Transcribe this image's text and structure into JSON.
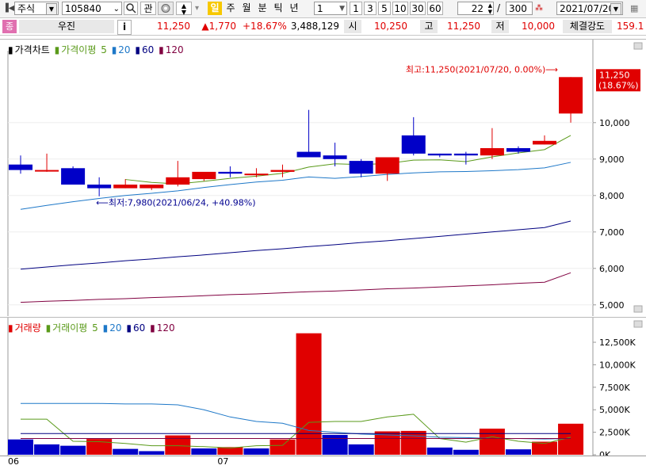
{
  "toolbar": {
    "market_type": "주식",
    "code": "105840",
    "search_icon_label": "search-icon",
    "watch_label": "관",
    "periods": [
      "일",
      "주",
      "월",
      "분",
      "틱",
      "년"
    ],
    "active_period": "일",
    "interval_value": "1",
    "intervals": [
      "1",
      "3",
      "5",
      "10",
      "30",
      "60"
    ],
    "count_value": "22",
    "slash": "/",
    "total_value": "300",
    "date_value": "2021/07/20"
  },
  "infobar": {
    "badge": "종",
    "name": "우진",
    "info_button": "i",
    "price": "11,250",
    "change": "▲1,770",
    "change_pct": "+18.67%",
    "volume": "3,488,129",
    "open_label": "시",
    "open_value": "10,250",
    "high_label": "고",
    "high_value": "11,250",
    "low_label": "저",
    "low_value": "10,000",
    "strength_label": "체결강도",
    "strength_value": "159.1"
  },
  "price_pane": {
    "legend_title": "가격차트",
    "legend_ma_label": "가격이평",
    "legend_periods": [
      "5",
      "20",
      "60",
      "120"
    ],
    "max_annotation": "최고:11,250(2021/07/20, 0.00%)⟶",
    "min_annotation": "⟵최저:7,980(2021/06/24, +40.98%)",
    "last_price_tag": "11,250",
    "last_pct_tag": "(18.67%)",
    "y_ticks": [
      "10,000",
      "9,000",
      "8,000",
      "7,000",
      "6,000",
      "5,000"
    ]
  },
  "volume_pane": {
    "legend_title": "거래량",
    "legend_ma_label": "거래이평",
    "legend_periods": [
      "5",
      "20",
      "60",
      "120"
    ],
    "y_ticks": [
      "12,500K",
      "10,000K",
      "7,500K",
      "5,000K",
      "2,500K",
      "0K"
    ]
  },
  "x_ticks": [
    "06",
    "07"
  ],
  "colors": {
    "up": "#e00000",
    "down": "#0000c8",
    "ma5": "#5a9a1a",
    "ma20": "#1e78c8",
    "ma60": "#000080",
    "ma120": "#800040"
  },
  "chart_data": [
    {
      "type": "candlestick",
      "title": "가격차트",
      "dates": [
        "2021/06/21",
        "2021/06/22",
        "2021/06/23",
        "2021/06/24",
        "2021/06/25",
        "2021/06/28",
        "2021/06/29",
        "2021/06/30",
        "2021/07/01",
        "2021/07/02",
        "2021/07/05",
        "2021/07/06",
        "2021/07/07",
        "2021/07/08",
        "2021/07/09",
        "2021/07/12",
        "2021/07/13",
        "2021/07/14",
        "2021/07/15",
        "2021/07/16",
        "2021/07/19",
        "2021/07/20"
      ],
      "open": [
        8850,
        8700,
        8750,
        8300,
        8200,
        8200,
        8300,
        8450,
        8650,
        8600,
        8650,
        9200,
        9100,
        8950,
        8600,
        9650,
        9150,
        9150,
        9100,
        9300,
        9400,
        10250
      ],
      "high": [
        9100,
        9150,
        8800,
        8500,
        8450,
        8300,
        8950,
        8600,
        8800,
        8750,
        8850,
        10350,
        9450,
        9000,
        9050,
        10150,
        9150,
        9200,
        9850,
        9350,
        9650,
        11250
      ],
      "low": [
        8600,
        8650,
        8300,
        7980,
        8200,
        8150,
        8250,
        8400,
        8500,
        8500,
        8500,
        9050,
        8800,
        8500,
        8400,
        9100,
        9050,
        8850,
        9000,
        9150,
        9400,
        10000
      ],
      "close": [
        8700,
        8700,
        8300,
        8200,
        8300,
        8300,
        8500,
        8650,
        8600,
        8600,
        8700,
        9050,
        9000,
        8600,
        9050,
        9150,
        9100,
        9100,
        9300,
        9200,
        9500,
        11250
      ],
      "ma_series": [
        {
          "name": "5",
          "values": [
            null,
            null,
            null,
            null,
            8440,
            8360,
            8320,
            8390,
            8470,
            8530,
            8610,
            8780,
            8870,
            8850,
            8880,
            8970,
            8980,
            8930,
            9060,
            9170,
            9260,
            9650
          ]
        },
        {
          "name": "20",
          "values": [
            7620,
            7730,
            7830,
            7920,
            8000,
            8060,
            8130,
            8220,
            8300,
            8370,
            8420,
            8510,
            8470,
            8520,
            8580,
            8620,
            8650,
            8660,
            8680,
            8710,
            8760,
            8910
          ]
        },
        {
          "name": "60",
          "values": [
            5980,
            6040,
            6100,
            6150,
            6210,
            6260,
            6320,
            6370,
            6430,
            6490,
            6540,
            6600,
            6650,
            6710,
            6760,
            6820,
            6880,
            6940,
            7000,
            7060,
            7120,
            7300
          ]
        },
        {
          "name": "120",
          "values": [
            5070,
            5100,
            5120,
            5150,
            5170,
            5200,
            5220,
            5250,
            5280,
            5300,
            5330,
            5360,
            5380,
            5410,
            5440,
            5460,
            5490,
            5520,
            5550,
            5590,
            5620,
            5880
          ]
        }
      ],
      "ylim": [
        4800,
        11800
      ]
    },
    {
      "type": "bar",
      "title": "거래량",
      "dates": [
        "2021/06/21",
        "2021/06/22",
        "2021/06/23",
        "2021/06/24",
        "2021/06/25",
        "2021/06/28",
        "2021/06/29",
        "2021/06/30",
        "2021/07/01",
        "2021/07/02",
        "2021/07/05",
        "2021/07/06",
        "2021/07/07",
        "2021/07/08",
        "2021/07/09",
        "2021/07/12",
        "2021/07/13",
        "2021/07/14",
        "2021/07/15",
        "2021/07/16",
        "2021/07/19",
        "2021/07/20"
      ],
      "values": [
        1700,
        1150,
        1000,
        1750,
        650,
        400,
        2150,
        700,
        850,
        700,
        1700,
        13500,
        2200,
        1150,
        2600,
        2650,
        800,
        550,
        2900,
        600,
        1450,
        3450
      ],
      "direction": [
        "down",
        "down",
        "down",
        "up",
        "down",
        "down",
        "up",
        "down",
        "up",
        "down",
        "up",
        "up",
        "down",
        "down",
        "up",
        "up",
        "down",
        "down",
        "up",
        "down",
        "up",
        "up"
      ],
      "ma_series": [
        {
          "name": "5",
          "values": [
            3950,
            3950,
            1500,
            1450,
            1250,
            1000,
            1000,
            900,
            750,
            1000,
            1050,
            3600,
            3700,
            3700,
            4200,
            4500,
            1800,
            1400,
            2000,
            1500,
            1250,
            1950
          ]
        },
        {
          "name": "20",
          "values": [
            5700,
            5700,
            5700,
            5700,
            5650,
            5650,
            5550,
            5000,
            4200,
            3700,
            3500,
            2700,
            2500,
            2300,
            2200,
            2100,
            1950,
            1900,
            1800,
            1800,
            1750,
            1800
          ]
        },
        {
          "name": "60",
          "values": [
            2350,
            2350,
            2350,
            2350,
            2350,
            2350,
            2350,
            2350,
            2350,
            2350,
            2350,
            2350,
            2350,
            2350,
            2350,
            2350,
            2350,
            2350,
            2350,
            2350,
            2350,
            2350
          ]
        },
        {
          "name": "120",
          "values": [
            1800,
            1800,
            1800,
            1800,
            1800,
            1800,
            1800,
            1800,
            1800,
            1800,
            1800,
            1800,
            1800,
            1800,
            1800,
            1800,
            1800,
            1800,
            1800,
            1800,
            1800,
            1800
          ]
        }
      ],
      "ylim": [
        0,
        14000
      ]
    }
  ]
}
